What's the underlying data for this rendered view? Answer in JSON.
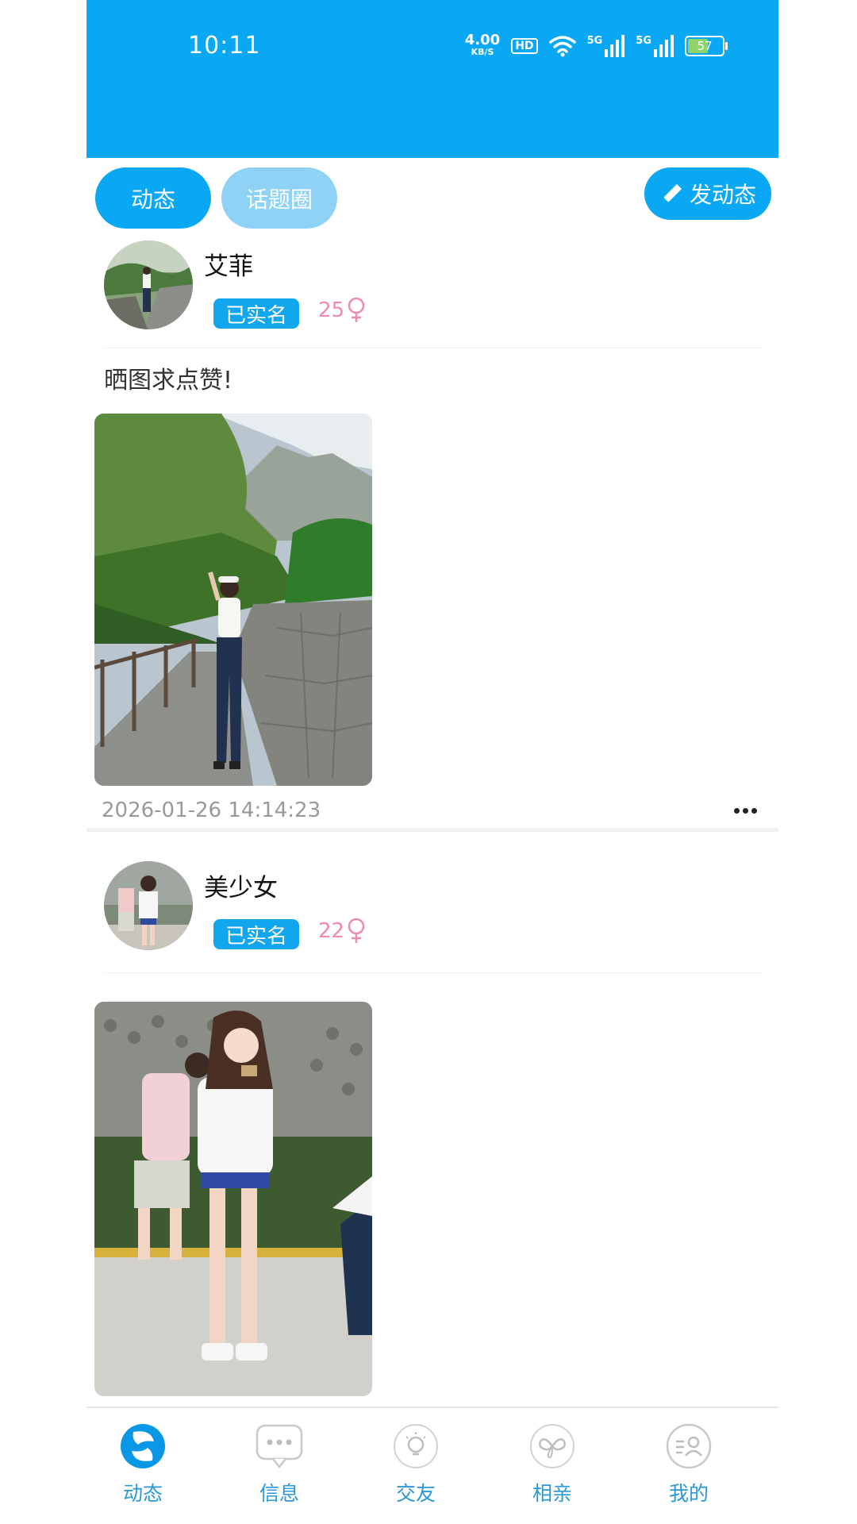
{
  "status_bar": {
    "time": "10:11",
    "net_speed": "4.00",
    "net_unit": "KB/S",
    "hd_badge": "HD",
    "signal_1": "5G",
    "signal_2": "5G",
    "battery": "57"
  },
  "tabs": {
    "dynamic": "动态",
    "topic_circle": "话题圈",
    "post_button": "发动态"
  },
  "posts": [
    {
      "username": "艾菲",
      "verified": "已实名",
      "age": "25",
      "gender_symbol": "♀",
      "text": "晒图求点赞!",
      "timestamp": "2026-01-26 14:14:23"
    },
    {
      "username": "美少女",
      "verified": "已实名",
      "age": "22",
      "gender_symbol": "♀",
      "text": ""
    }
  ],
  "bottom_nav": {
    "items": [
      {
        "label": "动态",
        "icon": "dynamic-icon",
        "active": true
      },
      {
        "label": "信息",
        "icon": "message-icon",
        "active": false
      },
      {
        "label": "交友",
        "icon": "friends-icon",
        "active": false
      },
      {
        "label": "相亲",
        "icon": "matchmaking-icon",
        "active": false
      },
      {
        "label": "我的",
        "icon": "profile-icon",
        "active": false
      }
    ]
  },
  "colors": {
    "accent": "#0aa8f4",
    "accent_light": "#8ed2f6",
    "gender_pink": "#ee8ab3"
  }
}
